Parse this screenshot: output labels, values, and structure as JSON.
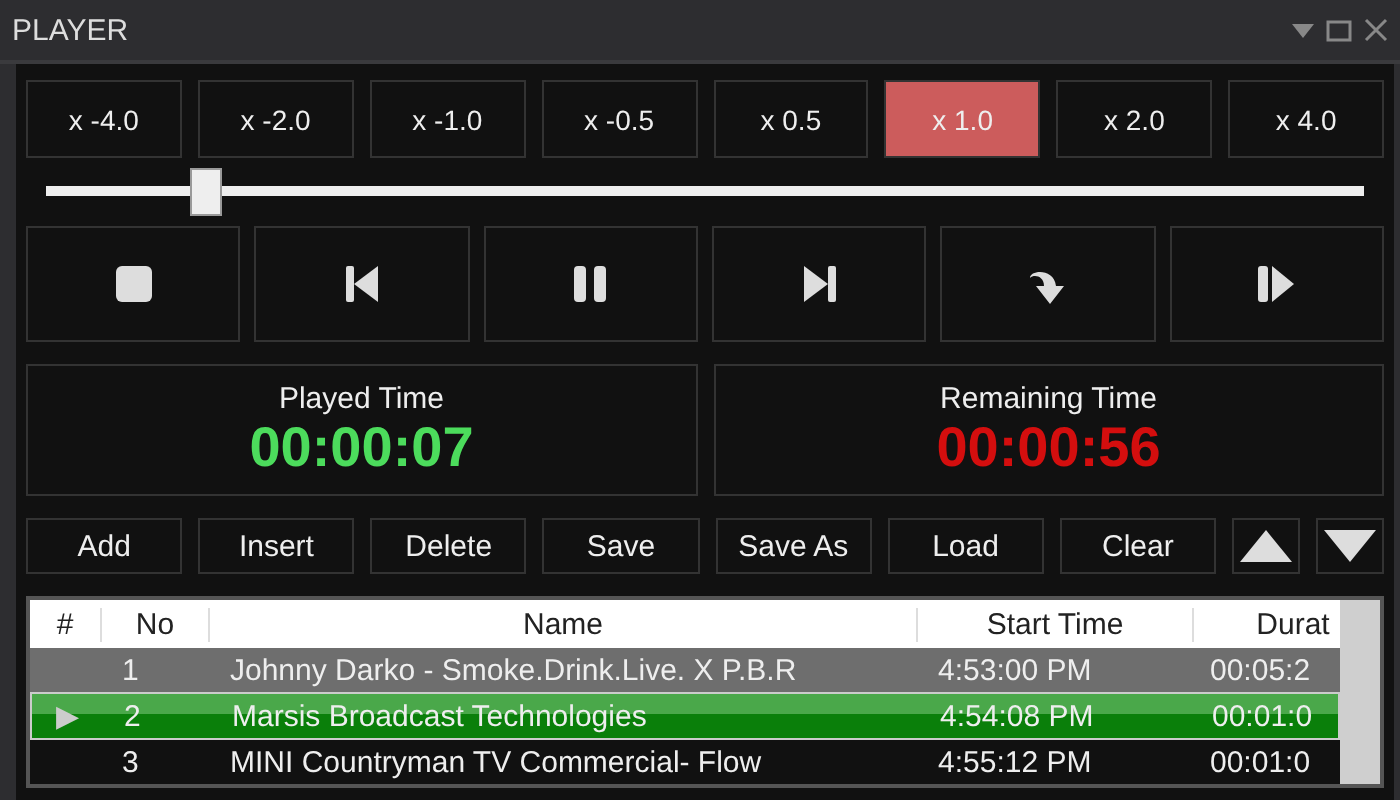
{
  "panel": {
    "title": "PLAYER"
  },
  "speeds": [
    {
      "label": "x -4.0",
      "selected": false
    },
    {
      "label": "x -2.0",
      "selected": false
    },
    {
      "label": "x -1.0",
      "selected": false
    },
    {
      "label": "x -0.5",
      "selected": false
    },
    {
      "label": "x 0.5",
      "selected": false
    },
    {
      "label": "x 1.0",
      "selected": true
    },
    {
      "label": "x 2.0",
      "selected": false
    },
    {
      "label": "x 4.0",
      "selected": false
    }
  ],
  "position_slider": {
    "level": 0.12
  },
  "transport": [
    {
      "kind": "stop"
    },
    {
      "kind": "previous"
    },
    {
      "kind": "pause"
    },
    {
      "kind": "next"
    },
    {
      "kind": "skip"
    },
    {
      "kind": "play"
    }
  ],
  "timers": [
    {
      "label": "Played Time",
      "value": "00:00:07",
      "kind": "played"
    },
    {
      "label": "Remaining Time",
      "value": "00:00:56",
      "kind": "remaining"
    }
  ],
  "actions": [
    {
      "label": "Add"
    },
    {
      "label": "Insert"
    },
    {
      "label": "Delete"
    },
    {
      "label": "Save"
    },
    {
      "label": "Save As"
    },
    {
      "label": "Load"
    },
    {
      "label": "Clear"
    }
  ],
  "move_buttons": [
    {
      "kind": "up"
    },
    {
      "kind": "down"
    }
  ],
  "playlist": {
    "columns": [
      "#",
      "No",
      "Name",
      "Start Time",
      "Durat"
    ],
    "rows": [
      {
        "marker": "",
        "no": "1",
        "name": "Johnny Darko - Smoke.Drink.Live. X P.B.R",
        "start": "4:53:00 PM",
        "duration": "00:05:2",
        "selected": true,
        "playing": false
      },
      {
        "marker": "▶",
        "no": "2",
        "name": "Marsis Broadcast Technologies",
        "start": "4:54:08 PM",
        "duration": "00:01:0",
        "selected": false,
        "playing": true
      },
      {
        "marker": "",
        "no": "3",
        "name": "MINI Countryman TV Commercial- Flow",
        "start": "4:55:12 PM",
        "duration": "00:01:0",
        "selected": false,
        "playing": false
      }
    ]
  }
}
